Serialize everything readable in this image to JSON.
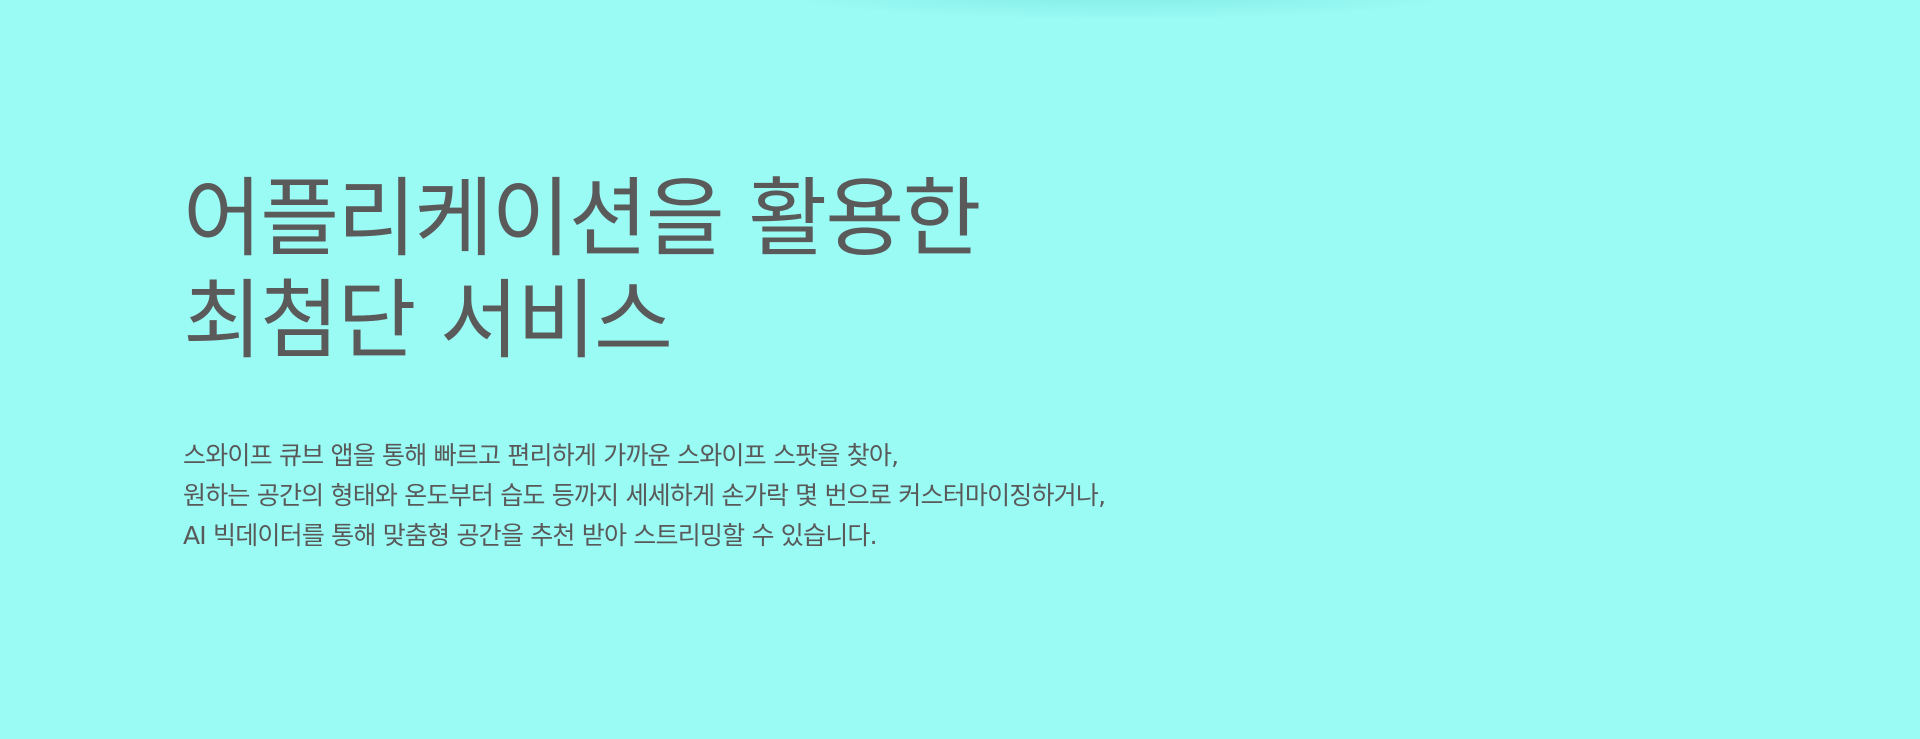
{
  "colors": {
    "background": "#9afaf4",
    "text": "#5a5a5a"
  },
  "hero": {
    "title_line_1": "어플리케이션을 활용한",
    "title_line_2": "최첨단 서비스",
    "description": [
      "스와이프 큐브 앱을 통해 빠르고 편리하게 가까운 스와이프 스팟을 찾아,",
      "원하는 공간의 형태와 온도부터 습도 등까지 세세하게 손가락 몇 번으로 커스터마이징하거나,",
      "AI 빅데이터를 통해 맞춤형 공간을 추천 받아 스트리밍할 수 있습니다."
    ]
  }
}
